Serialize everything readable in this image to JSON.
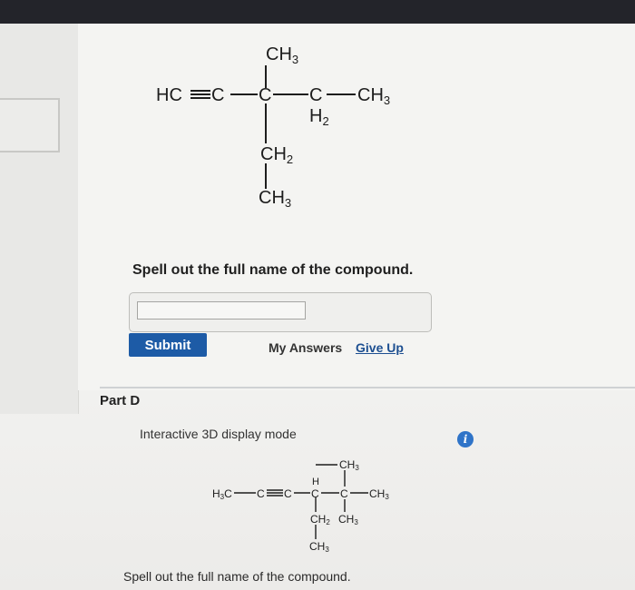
{
  "structure_c": {
    "ch3_top": "CH",
    "ch3_top_sub": "3",
    "hc": "HC",
    "c1": "C",
    "c2": "C",
    "c3": "C",
    "ch3_right": "CH",
    "ch3_right_sub": "3",
    "h2": "H",
    "h2_sub": "2",
    "ch2_mid": "CH",
    "ch2_mid_sub": "2",
    "ch3_bottom": "CH",
    "ch3_bottom_sub": "3"
  },
  "question_c": {
    "prompt": "Spell out the full name of the compound.",
    "answer_value": "",
    "submit_label": "Submit",
    "my_answers_label": "My Answers",
    "give_up_label": "Give Up"
  },
  "part_d": {
    "label": "Part D",
    "mode_text": "Interactive 3D display mode",
    "info_icon": "i",
    "prompt": "Spell out the full name of the compound."
  },
  "structure_d": {
    "h3c": "H",
    "h3c_sub": "3",
    "h3c_c": "C",
    "c_a": "C",
    "c_b": "C",
    "c_h": "C",
    "h_top": "H",
    "ch3_top": "CH",
    "ch3_top_sub": "3",
    "c_q": "C",
    "ch3_right": "CH",
    "ch3_right_sub": "3",
    "ch2": "CH",
    "ch2_sub": "2",
    "ch3_under_q": "CH",
    "ch3_under_q_sub": "3",
    "ch3_bottom": "CH",
    "ch3_bottom_sub": "3"
  }
}
